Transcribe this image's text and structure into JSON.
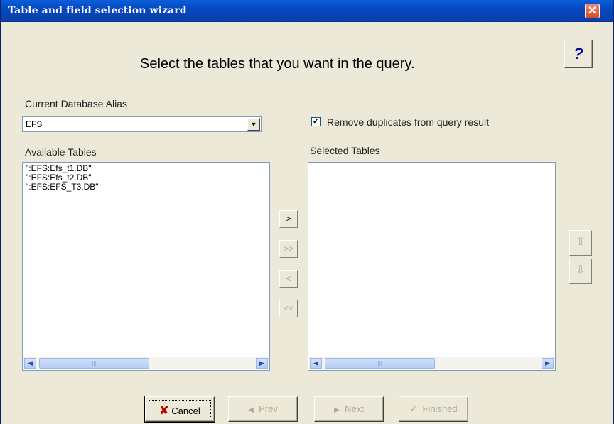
{
  "window": {
    "title": "Table and field selection wizard",
    "close_glyph": "✕"
  },
  "help": {
    "glyph": "?"
  },
  "heading": "Select the tables that you want in the query.",
  "alias": {
    "label": "Current Database Alias",
    "value": "EFS",
    "arrow": "▼"
  },
  "duplicates": {
    "checked": true,
    "check_glyph": "✓",
    "label": "Remove duplicates from query result"
  },
  "available": {
    "label": "Available Tables",
    "items": [
      "\":EFS:Efs_t1.DB\"",
      "\":EFS:Efs_t2.DB\"",
      "\":EFS:EFS_T3.DB\""
    ]
  },
  "selected": {
    "label": "Selected Tables",
    "items": []
  },
  "scroll": {
    "left": "◀",
    "right": "▶",
    "grip": "|||"
  },
  "transfer": {
    "add": ">",
    "add_all": ">>",
    "remove": "<",
    "remove_all": "<<"
  },
  "order": {
    "up": "⇧",
    "down": "⇩"
  },
  "buttons": {
    "cancel_icon": "✘",
    "cancel": "Cancel",
    "prev_icon": "◀",
    "prev": "Prev",
    "next_icon": "▶",
    "next": "Next",
    "finished_icon": "✓",
    "finished": "Finished"
  },
  "colors": {
    "titlebar": "#0548c2",
    "window_bg": "#ece9d8",
    "cancel_icon": "#c00000"
  }
}
